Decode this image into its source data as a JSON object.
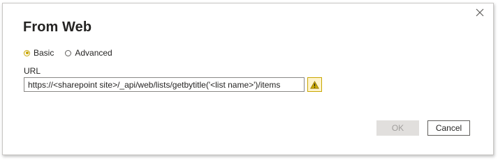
{
  "dialog": {
    "title": "From Web",
    "close_icon": "close-icon"
  },
  "mode": {
    "options": [
      {
        "label": "Basic",
        "selected": true
      },
      {
        "label": "Advanced",
        "selected": false
      }
    ]
  },
  "url": {
    "label": "URL",
    "value": "https://<sharepoint site>/_api/web/lists/getbytitle('<list name>')/items",
    "warning_icon": "warning-icon"
  },
  "buttons": {
    "ok_label": "OK",
    "cancel_label": "Cancel"
  },
  "colors": {
    "accent": "#c8a600",
    "warning_bg": "#fff4ce",
    "disabled_bg": "#e1dfdd"
  }
}
